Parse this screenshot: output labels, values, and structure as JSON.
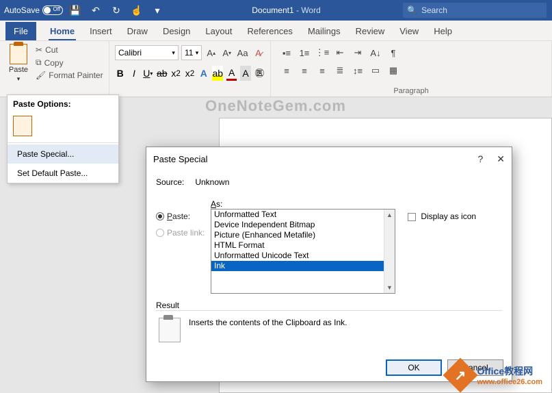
{
  "titlebar": {
    "autosave_label": "AutoSave",
    "autosave_state": "Off",
    "doc_name": "Document1",
    "app_name": "Word",
    "search_placeholder": "Search"
  },
  "tabs": {
    "file": "File",
    "home": "Home",
    "insert": "Insert",
    "draw": "Draw",
    "design": "Design",
    "layout": "Layout",
    "references": "References",
    "mailings": "Mailings",
    "review": "Review",
    "view": "View",
    "help": "Help"
  },
  "ribbon": {
    "paste": "Paste",
    "cut": "Cut",
    "copy": "Copy",
    "format_painter": "Format Painter",
    "font_name": "Calibri",
    "font_size": "11",
    "paragraph_label": "Paragraph"
  },
  "watermark1": "OneNoteGem.com",
  "paste_menu": {
    "header": "Paste Options:",
    "paste_special": "Paste Special...",
    "set_default": "Set Default Paste..."
  },
  "dialog": {
    "title": "Paste Special",
    "help": "?",
    "close": "✕",
    "source_lbl": "Source:",
    "source_val": "Unknown",
    "paste_radio": "Paste:",
    "pastelink_radio": "Paste link:",
    "as_lbl": "As:",
    "options": [
      "Unformatted Text",
      "Device Independent Bitmap",
      "Picture (Enhanced Metafile)",
      "HTML Format",
      "Unformatted Unicode Text",
      "Ink"
    ],
    "selected_index": 5,
    "display_icon": "Display as icon",
    "result_lbl": "Result",
    "result_text": "Inserts the contents of the Clipboard as Ink.",
    "ok": "OK",
    "cancel": "Cancel"
  },
  "corner": {
    "line1": "Office教程网",
    "line2": "www.office26.com"
  }
}
